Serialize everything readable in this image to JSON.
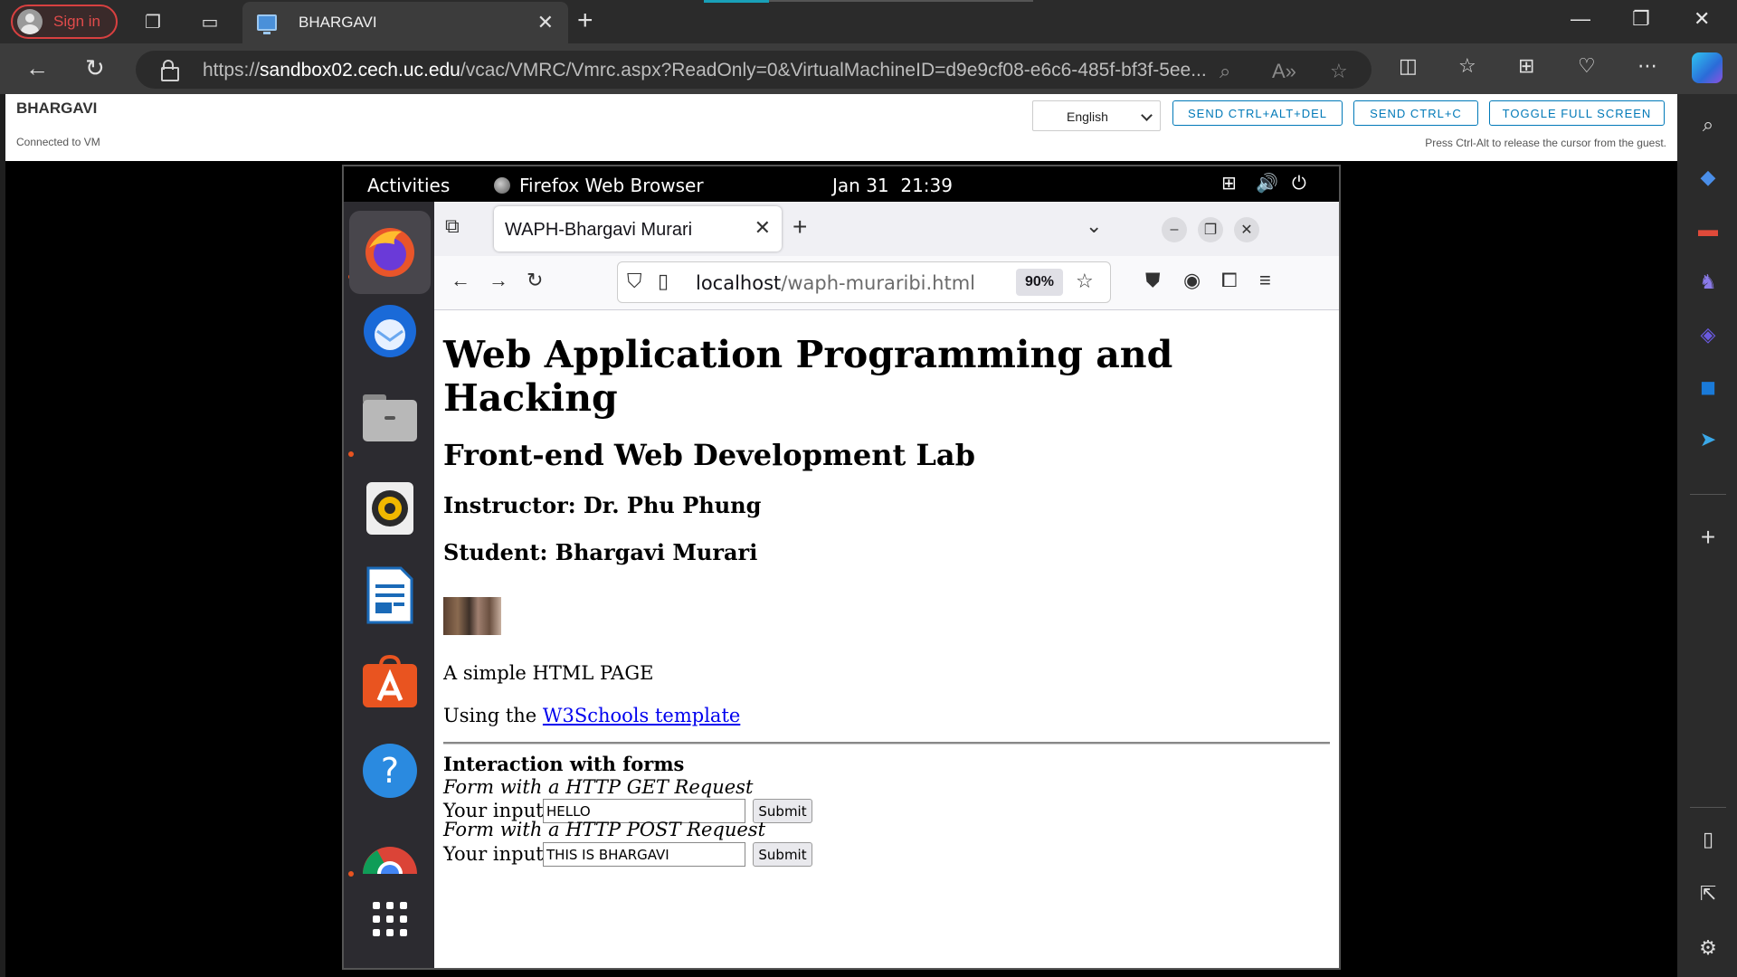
{
  "edge": {
    "signin_label": "Sign in",
    "tab_title": "BHARGAVI",
    "url_host": "sandbox02.cech.uc.edu",
    "url_prefix": "https://",
    "url_path": "/vcac/VMRC/Vmrc.aspx?ReadOnly=0&VirtualMachineID=d9e9cf08-e6c6-485f-bf3f-5ee..."
  },
  "vmrc": {
    "title": "BHARGAVI",
    "status": "Connected to VM",
    "language": "English",
    "btn_ctrl_alt_del": "SEND CTRL+ALT+DEL",
    "btn_ctrl_c": "SEND CTRL+C",
    "btn_fullscreen": "TOGGLE FULL SCREEN",
    "hint": "Press Ctrl-Alt to release the cursor from the guest."
  },
  "gnome": {
    "activities": "Activities",
    "app_name": "Firefox Web Browser",
    "date": "Jan 31",
    "time": "21:39"
  },
  "firefox": {
    "tab_title": "WAPH-Bhargavi Murari",
    "url_host": "localhost",
    "url_path": "/waph-muraribi.html",
    "zoom": "90%"
  },
  "page": {
    "h1": "Web Application Programming and Hacking",
    "h2": "Front-end Web Development Lab",
    "instructor": "Instructor: Dr. Phu Phung",
    "student": "Student: Bhargavi Murari",
    "p1": "A simple HTML PAGE",
    "p2_prefix": "Using the ",
    "p2_link": "W3Schools template",
    "forms_heading": "Interaction with forms",
    "get_form_title": "Form with a HTTP GET Request",
    "get_label": "Your input:",
    "get_value": "HELLO",
    "post_form_title": "Form with a HTTP POST Request",
    "post_label": "Your input:",
    "post_value": "THIS IS BHARGAVI",
    "submit_label": "Submit"
  }
}
